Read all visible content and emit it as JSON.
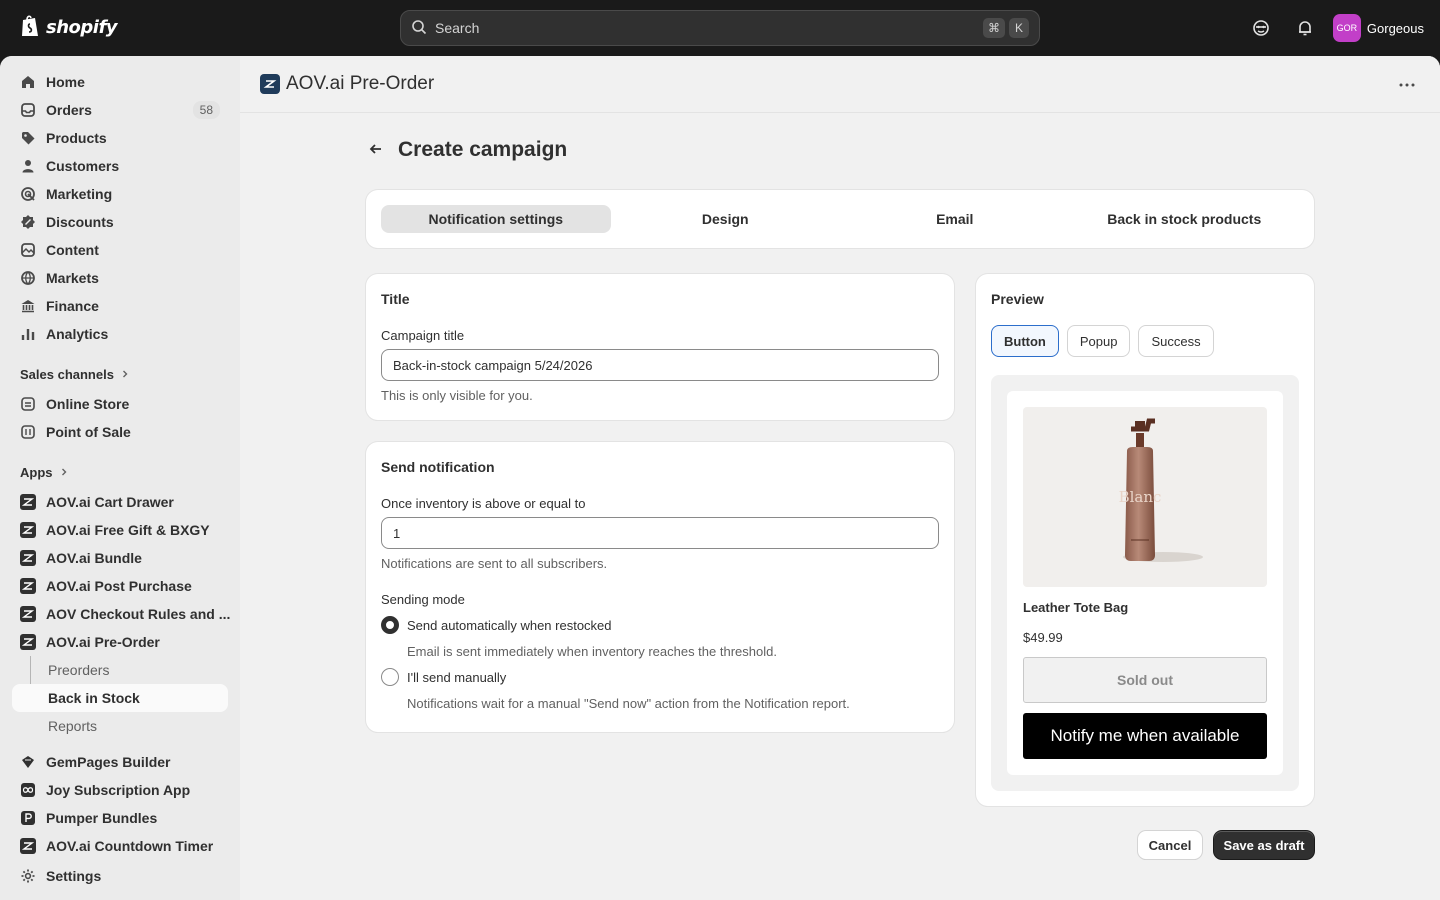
{
  "topbar": {
    "brand": "shopify",
    "search_placeholder": "Search",
    "shortcut_cmd": "⌘",
    "shortcut_key": "K",
    "store_initials": "GOR",
    "store_name": "Gorgeous"
  },
  "sidebar": {
    "main_items": [
      {
        "label": "Home",
        "icon": "home-icon"
      },
      {
        "label": "Orders",
        "icon": "orders-icon",
        "badge": "58"
      },
      {
        "label": "Products",
        "icon": "tag-icon"
      },
      {
        "label": "Customers",
        "icon": "person-icon"
      },
      {
        "label": "Marketing",
        "icon": "target-icon"
      },
      {
        "label": "Discounts",
        "icon": "discount-icon"
      },
      {
        "label": "Content",
        "icon": "content-icon"
      },
      {
        "label": "Markets",
        "icon": "globe-icon"
      },
      {
        "label": "Finance",
        "icon": "bank-icon"
      },
      {
        "label": "Analytics",
        "icon": "chart-icon"
      }
    ],
    "sales_channels_label": "Sales channels",
    "sales_channels": [
      {
        "label": "Online Store"
      },
      {
        "label": "Point of Sale"
      }
    ],
    "apps_label": "Apps",
    "apps": [
      {
        "label": "AOV.ai Cart Drawer"
      },
      {
        "label": "AOV.ai Free Gift & BXGY"
      },
      {
        "label": "AOV.ai Bundle"
      },
      {
        "label": "AOV.ai Post Purchase"
      },
      {
        "label": "AOV Checkout Rules and ..."
      },
      {
        "label": "AOV.ai Pre-Order"
      }
    ],
    "sub_items": [
      {
        "label": "Preorders"
      },
      {
        "label": "Back in Stock"
      },
      {
        "label": "Reports"
      }
    ],
    "more_apps": [
      {
        "label": "GemPages Builder"
      },
      {
        "label": "Joy Subscription App"
      },
      {
        "label": "Pumper Bundles"
      },
      {
        "label": "AOV.ai Countdown Timer"
      }
    ],
    "settings_label": "Settings"
  },
  "app_header": {
    "title": "AOV.ai Pre-Order"
  },
  "page": {
    "title": "Create campaign",
    "tabs": [
      {
        "label": "Notification settings"
      },
      {
        "label": "Design"
      },
      {
        "label": "Email"
      },
      {
        "label": "Back in stock products"
      }
    ]
  },
  "title_card": {
    "heading": "Title",
    "field_label": "Campaign title",
    "field_value": "Back-in-stock campaign 5/24/2026",
    "help": "This is only visible for you."
  },
  "send_card": {
    "heading": "Send notification",
    "inventory_label": "Once inventory is above or equal to",
    "inventory_value": "1",
    "inventory_help": "Notifications are sent to all subscribers.",
    "mode_label": "Sending mode",
    "option_auto": "Send automatically when restocked",
    "option_auto_help": "Email is sent immediately when inventory reaches the threshold.",
    "option_manual": "I'll send manually",
    "option_manual_help": "Notifications wait for a manual \"Send now\" action from the Notification report."
  },
  "preview": {
    "heading": "Preview",
    "buttons": [
      {
        "label": "Button"
      },
      {
        "label": "Popup"
      },
      {
        "label": "Success"
      }
    ],
    "product_name": "Leather Tote Bag",
    "product_price": "$49.99",
    "sold_out_label": "Sold out",
    "notify_label": "Notify me when available",
    "bottle_brand": "Blanc"
  },
  "actions": {
    "cancel": "Cancel",
    "save": "Save as draft"
  }
}
